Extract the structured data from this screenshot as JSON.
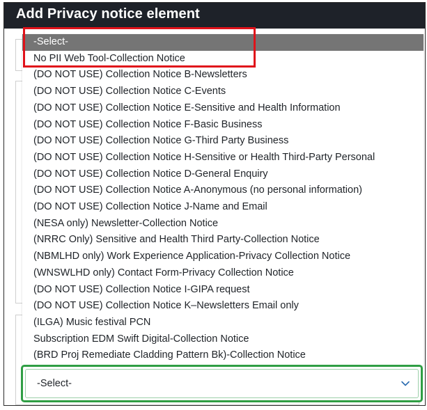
{
  "dialog": {
    "title": "Add Privacy notice element"
  },
  "dropdown": {
    "options": [
      "-Select-",
      "No PII Web Tool-Collection Notice",
      "(DO NOT USE) Collection Notice B-Newsletters",
      "(DO NOT USE) Collection Notice C-Events",
      "(DO NOT USE) Collection Notice E-Sensitive and Health Information",
      "(DO NOT USE) Collection Notice F-Basic Business",
      "(DO NOT USE) Collection Notice G-Third Party Business",
      "(DO NOT USE) Collection Notice H-Sensitive or Health Third-Party Personal",
      "(DO NOT USE) Collection Notice D-General Enquiry",
      "(DO NOT USE) Collection Notice A-Anonymous (no personal information)",
      "(DO NOT USE) Collection Notice J-Name and Email",
      "(NESA only) Newsletter-Collection Notice",
      "(NRRC Only) Sensitive and Health Third Party-Collection Notice",
      "(NBMLHD only) Work Experience Application-Privacy Collection Notice",
      "(WNSWLHD only) Contact Form-Privacy Collection Notice",
      "(DO NOT USE) Collection Notice I-GIPA request",
      "(DO NOT USE) Collection Notice K–Newsletters Email only",
      "(ILGA) Music festival PCN",
      "Subscription EDM Swift Digital-Collection Notice",
      "(BRD Proj Remediate Cladding Pattern Bk)-Collection Notice"
    ],
    "highlighted_index": 0
  },
  "select": {
    "value": "-Select-",
    "icon": "chevron-down-icon"
  },
  "colors": {
    "header_bg": "#1e2229",
    "highlight_bg": "#757575",
    "annotation": "#e0121a",
    "focus_border": "#2f9e44"
  }
}
